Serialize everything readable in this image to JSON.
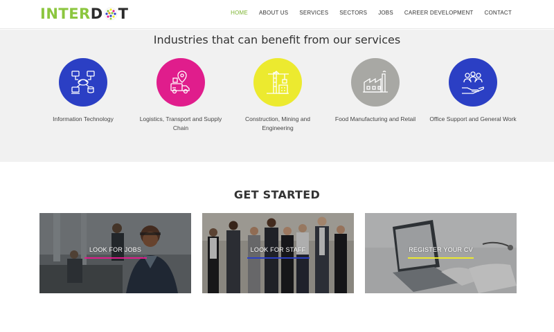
{
  "brand": {
    "logo_part1": "INTER",
    "logo_part3": "T",
    "accent": "#8cc63f"
  },
  "nav": {
    "items": [
      {
        "label": "HOME",
        "active": true
      },
      {
        "label": "ABOUT US"
      },
      {
        "label": "SERVICES"
      },
      {
        "label": "SECTORS"
      },
      {
        "label": "JOBS"
      },
      {
        "label": "CAREER DEVELOPMENT"
      },
      {
        "label": "CONTACT"
      }
    ]
  },
  "industries": {
    "title": "Industries that can benefit from our services",
    "items": [
      {
        "label": "Information Technology",
        "icon": "it-network-icon",
        "color": "#2b3fc4"
      },
      {
        "label": "Logistics, Transport and Supply Chain",
        "icon": "logistics-truck-icon",
        "color": "#e01d8c"
      },
      {
        "label": "Construction, Mining and Engineering",
        "icon": "construction-crane-icon",
        "color": "#ecea2f"
      },
      {
        "label": "Food Manufacturing and Retail",
        "icon": "factory-icon",
        "color": "#a8a8a4"
      },
      {
        "label": "Office Support and General Work",
        "icon": "people-hand-icon",
        "color": "#2b3fc4"
      }
    ]
  },
  "get_started": {
    "title": "GET STARTED",
    "cards": [
      {
        "label": "LOOK FOR JOBS",
        "line_color": "#e01d8c"
      },
      {
        "label": "LOOK FOR STAFF",
        "line_color": "#2b3fc4"
      },
      {
        "label": "REGISTER YOUR CV",
        "line_color": "#ecea2f"
      }
    ]
  }
}
